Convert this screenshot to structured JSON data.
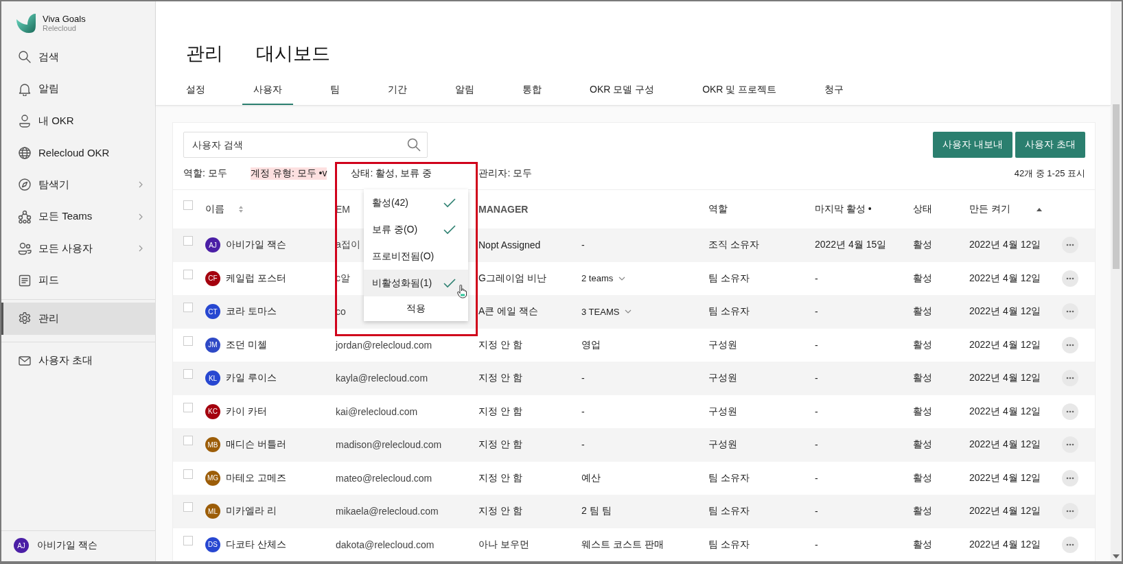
{
  "sidebar": {
    "brand": {
      "name": "Viva Goals",
      "org": "Relecloud"
    },
    "groups": [
      {
        "items": [
          {
            "label": "검색",
            "selected": false,
            "has_submenu": false
          },
          {
            "label": "알림",
            "selected": false,
            "has_submenu": false
          },
          {
            "label": "내 OKR",
            "selected": false,
            "has_submenu": false
          },
          {
            "label": "Relecloud OKR",
            "selected": false,
            "has_submenu": false
          },
          {
            "label": "탐색기",
            "selected": false,
            "has_submenu": true
          },
          {
            "label": "모든 Teams",
            "selected": false,
            "has_submenu": true
          },
          {
            "label": "모든 사용자",
            "selected": false,
            "has_submenu": true
          },
          {
            "label": "피드",
            "selected": false,
            "has_submenu": false
          }
        ]
      },
      {
        "items": [
          {
            "label": "관리",
            "selected": true,
            "has_submenu": false
          }
        ]
      },
      {
        "items": [
          {
            "label": "사용자 초대",
            "selected": false,
            "has_submenu": false
          }
        ]
      }
    ],
    "user": {
      "initials": "AJ",
      "name": "아비가일 잭슨"
    }
  },
  "title": {
    "section": "관리",
    "page": "대시보드"
  },
  "tabs": [
    {
      "label": "설정",
      "selected": false
    },
    {
      "label": "사용자",
      "selected": true
    },
    {
      "label": "팀",
      "selected": false
    },
    {
      "label": "기간",
      "selected": false
    },
    {
      "label": "알림",
      "selected": false
    },
    {
      "label": "통합",
      "selected": false
    },
    {
      "label": "OKR 모델 구성",
      "selected": false
    },
    {
      "label": "OKR 및 프로젝트",
      "selected": false
    },
    {
      "label": "청구",
      "selected": false
    }
  ],
  "search": {
    "placeholder": "사용자 검색"
  },
  "buttons": [
    {
      "label": "사용자 내보내"
    },
    {
      "label": "사용자 초대"
    }
  ],
  "filters": [
    {
      "label": "역할: 모두",
      "highlighted": false
    },
    {
      "label": "계정 유형: 모두 •v",
      "highlighted": true
    },
    {
      "label": "상태: 활성, 보류 중",
      "highlighted": false
    },
    {
      "label": "관리자: 모두",
      "highlighted": false
    }
  ],
  "count": "42개 중 1-25 표시",
  "table": {
    "header_checked": false,
    "columns": {
      "name": {
        "label": "이름",
        "sorted_ascending": false
      },
      "email": {
        "label": "EM"
      },
      "manager": {
        "label": "MANAGER"
      },
      "role": {
        "label": "역할"
      },
      "last_active": {
        "label": "마지막 활성 •"
      },
      "status": {
        "label": "상태"
      },
      "created": {
        "label": "만든 켜기",
        "sorted_ascending": true
      }
    },
    "rows": [
      {
        "checked": false,
        "initials": "AJ",
        "color": "#4b1fa6",
        "name": "아비가일 잭슨",
        "email": "a접이",
        "manager": "Nopt Assigned",
        "teams": "-",
        "teams_expandable": false,
        "role": "조직 소유자",
        "last_active": "2022년 4월 15일",
        "status": "활성",
        "created": "2022년 4월 12일"
      },
      {
        "checked": false,
        "initials": "CF",
        "color": "#a4000e",
        "name": "케일럽 포스터",
        "email": "c알",
        "manager": "G그레이엄 비난",
        "teams": "2 teams",
        "teams_expandable": true,
        "role": "팀 소유자",
        "last_active": "-",
        "status": "활성",
        "created": "2022년 4월 12일"
      },
      {
        "checked": false,
        "initials": "CT",
        "color": "#2747d1",
        "name": "코라 토마스",
        "email": "co",
        "manager": "A큰 에일 잭슨",
        "teams": "3 TEAMS",
        "teams_expandable": true,
        "role": "팀 소유자",
        "last_active": "-",
        "status": "활성",
        "created": "2022년 4월 12일"
      },
      {
        "checked": false,
        "initials": "JM",
        "color": "#2e49c6",
        "name": "조던 미첼",
        "email": "jordan@relecloud.com",
        "manager": "지정 안 함",
        "teams": "영업",
        "teams_expandable": false,
        "role": "구성원",
        "last_active": "-",
        "status": "활성",
        "created": "2022년 4월 12일"
      },
      {
        "checked": false,
        "initials": "KL",
        "color": "#2747d1",
        "name": "카일 루이스",
        "email": "kayla@relecloud.com",
        "manager": "지정 안 함",
        "teams": "-",
        "teams_expandable": false,
        "role": "구성원",
        "last_active": "-",
        "status": "활성",
        "created": "2022년 4월 12일"
      },
      {
        "checked": false,
        "initials": "KC",
        "color": "#a4000e",
        "name": "카이 카터",
        "email": "kai@relecloud.com",
        "manager": "지정 안 함",
        "teams": "-",
        "teams_expandable": false,
        "role": "구성원",
        "last_active": "-",
        "status": "활성",
        "created": "2022년 4월 12일"
      },
      {
        "checked": false,
        "initials": "MB",
        "color": "#9c5d08",
        "name": "매디슨 버틀러",
        "email": "madison@relecloud.com",
        "manager": "지정 안 함",
        "teams": "-",
        "teams_expandable": false,
        "role": "구성원",
        "last_active": "-",
        "status": "활성",
        "created": "2022년 4월 12일"
      },
      {
        "checked": false,
        "initials": "MG",
        "color": "#9c5d08",
        "name": "마테오 고메즈",
        "email": "mateo@relecloud.com",
        "manager": "지정 안 함",
        "teams": "예산",
        "teams_expandable": false,
        "role": "팀 소유자",
        "last_active": "-",
        "status": "활성",
        "created": "2022년 4월 12일"
      },
      {
        "checked": false,
        "initials": "ML",
        "color": "#9c5d08",
        "name": "미카엘라 리",
        "email": "mikaela@relecloud.com",
        "manager": "지정 안 함",
        "teams": "2 팀 팀",
        "teams_expandable": false,
        "role": "팀 소유자",
        "last_active": "-",
        "status": "활성",
        "created": "2022년 4월 12일"
      },
      {
        "checked": false,
        "initials": "DS",
        "color": "#2747d1",
        "name": "다코타 산체스",
        "email": "dakota@relecloud.com",
        "manager": "아나 보우먼",
        "teams": "웨스트 코스트 판매",
        "teams_expandable": false,
        "role": "팀 소유자",
        "last_active": "-",
        "status": "활성",
        "created": "2022년 4월 12일"
      }
    ]
  },
  "status_menu": {
    "items": [
      {
        "label": "활성(42)",
        "checked": true,
        "hovered": false
      },
      {
        "label": "보류 중(O)",
        "checked": true,
        "hovered": false
      },
      {
        "label": "프로비전됨(O)",
        "checked": false,
        "hovered": false
      },
      {
        "label": "비활성화됨(1)",
        "checked": true,
        "hovered": true
      }
    ],
    "apply": "적용"
  }
}
